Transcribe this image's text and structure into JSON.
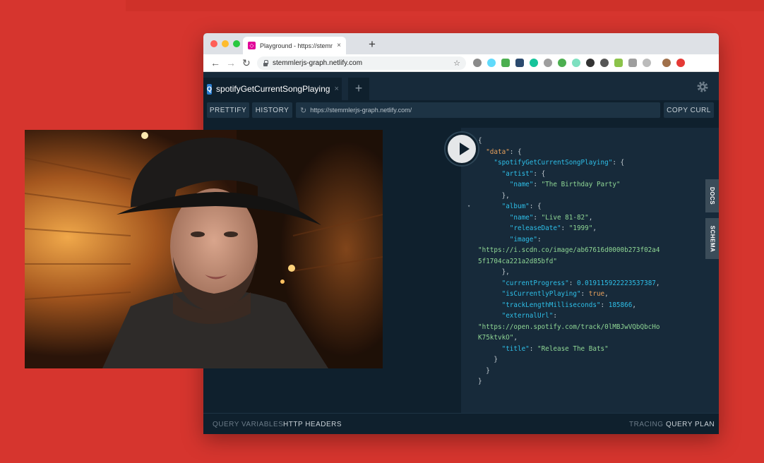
{
  "browser": {
    "tab_title": "Playground - https://stemmlerjs",
    "favicon_glyph": "◇",
    "tab_close": "×",
    "new_tab": "+",
    "address": "stemmlerjs-graph.netlify.com",
    "back": "←",
    "forward": "→",
    "reload": "↻",
    "star": "☆"
  },
  "playground": {
    "tab_badge": "Q",
    "tab_title": "spotifyGetCurrentSongPlaying",
    "tab_close": "×",
    "add_tab": "+",
    "prettify": "PRETTIFY",
    "history": "HISTORY",
    "endpoint": "https://stemmlerjs-graph.netlify.com/",
    "endpoint_reload": "↻",
    "copy_curl": "COPY CURL",
    "docs_tab": "DOCS",
    "schema_tab": "SCHEMA",
    "footer": {
      "query_variables": "QUERY VARIABLES",
      "http_headers": "HTTP HEADERS",
      "tracing": "TRACING",
      "query_plan": "QUERY PLAN"
    }
  },
  "result": {
    "k_data": "\"data\"",
    "k_query": "\"spotifyGetCurrentSongPlaying\"",
    "k_artist": "\"artist\"",
    "k_name": "\"name\"",
    "artist_name": "\"The Birthday Party\"",
    "k_album": "\"album\"",
    "album_name": "\"Live 81-82\"",
    "k_release": "\"releaseDate\"",
    "release_date": "\"1999\"",
    "k_image": "\"image\"",
    "image_1": "\"https://i.scdn.co/image/ab67616d0000b273f02a4",
    "image_2": "5f1704ca221a2d85bfd\"",
    "k_progress": "\"currentProgress\"",
    "progress": "0.019115922223537387",
    "k_playing": "\"isCurrentlyPlaying\"",
    "playing": "true",
    "k_length": "\"trackLengthMilliseconds\"",
    "length": "185866",
    "k_external": "\"externalUrl\"",
    "external_1": "\"https://open.spotify.com/track/0lMBJwVQbQbcHo",
    "external_2": "K75ktvkO\"",
    "k_title": "\"title\"",
    "title": "\"Release The Bats\""
  },
  "colors": {
    "background": "#d6352e",
    "playground_bg": "#0f202d",
    "result_bg": "#172a3a",
    "json_key": "#2ebfe8",
    "json_string": "#8fd694",
    "json_bool": "#e6a05c"
  }
}
